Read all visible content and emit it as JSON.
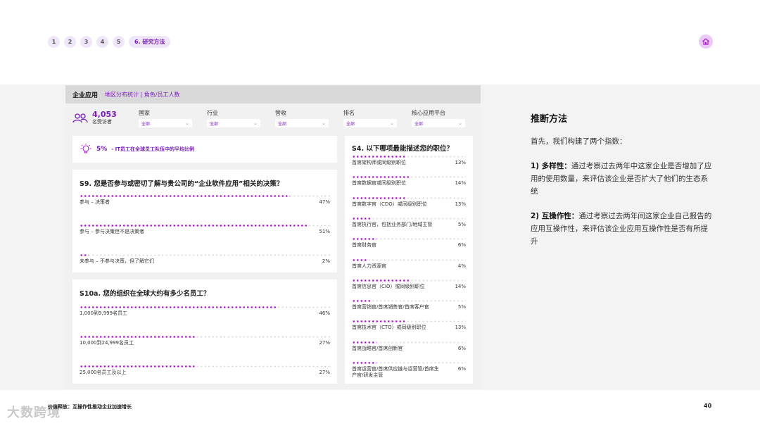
{
  "nav": {
    "items": [
      "1",
      "2",
      "3",
      "4",
      "5"
    ],
    "active": "6. 研究方法"
  },
  "dashboard": {
    "title": "企业应用",
    "subtitle": "地区分布统计 | 角色/员工人数",
    "visitors_count": "4,053",
    "visitors_label": "名受访者",
    "filters": [
      {
        "label": "国家",
        "value": "全部"
      },
      {
        "label": "行业",
        "value": "全部"
      },
      {
        "label": "营收",
        "value": "全部"
      },
      {
        "label": "排名",
        "value": "全部"
      },
      {
        "label": "核心应用平台",
        "value": "全部"
      }
    ],
    "highlight": {
      "pct": "5%",
      "text": "- IT员工在全球员工队伍中的平均比例"
    },
    "s9": {
      "title": "S9. 您是否参与或密切了解与贵公司的“企业软件应用”相关的决策？",
      "rows": [
        {
          "label": "参与 – 决策者",
          "value": "47%",
          "pct": 47
        },
        {
          "label": "参与 – 参与决策但不是决策者",
          "value": "51%",
          "pct": 51
        },
        {
          "label": "未参与 – 不参与决策，但了解它们",
          "value": "2%",
          "pct": 2
        }
      ]
    },
    "s10a": {
      "title": "S10a. 您的组织在全球大约有多少名员工？",
      "rows": [
        {
          "label": "1,000到9,999名员工",
          "value": "46%",
          "pct": 46
        },
        {
          "label": "10,000到24,999名员工",
          "value": "27%",
          "pct": 27
        },
        {
          "label": "25,000名员工及以上",
          "value": "27%",
          "pct": 27
        }
      ]
    },
    "s4": {
      "title": "S4. 以下哪项最能描述您的职位？",
      "rows": [
        {
          "label": "首席架构师或同级别职位",
          "value": "13%",
          "pct": 13
        },
        {
          "label": "首席数据官或同级别职位",
          "value": "14%",
          "pct": 14
        },
        {
          "label": "首席数字官（CDO）或同级别职位",
          "value": "13%",
          "pct": 13
        },
        {
          "label": "首席执行官，包括业务部门/地域主管",
          "value": "5%",
          "pct": 5
        },
        {
          "label": "首席财务官",
          "value": "6%",
          "pct": 6
        },
        {
          "label": "首席人力资源官",
          "value": "4%",
          "pct": 4
        },
        {
          "label": "首席信息官（CIO）或同级别职位",
          "value": "14%",
          "pct": 14
        },
        {
          "label": "首席营销官/首席销售官/首席客户官",
          "value": "5%",
          "pct": 5
        },
        {
          "label": "首席技术官（CTO）或同级别职位",
          "value": "13%",
          "pct": 13
        },
        {
          "label": "首席战略官/首席创新官",
          "value": "6%",
          "pct": 6
        },
        {
          "label": "首席运营官/首席供应链与运营管/首席生产官/研发主管",
          "value": "6%",
          "pct": 6
        }
      ]
    }
  },
  "method": {
    "title": "推断方法",
    "intro": "首先，我们构建了两个指数：",
    "p1_head": "1) 多样性：",
    "p1_body": "通过考察过去两年中这家企业是否增加了应用的使用数量，来评估该企业是否扩大了他们的生态系统",
    "p2_head": "2) 互操作性：",
    "p2_body": "通过考察过去两年间这家企业自己报告的应用互操作性，来评估该企业应用互操作性是否有所提升"
  },
  "footer": {
    "text": "价值释放：互操作性推动企业加速增长",
    "page": "40",
    "watermark": "大数跨境"
  },
  "colors": {
    "accent": "#7a1bc2",
    "dot": "#b515e0"
  }
}
